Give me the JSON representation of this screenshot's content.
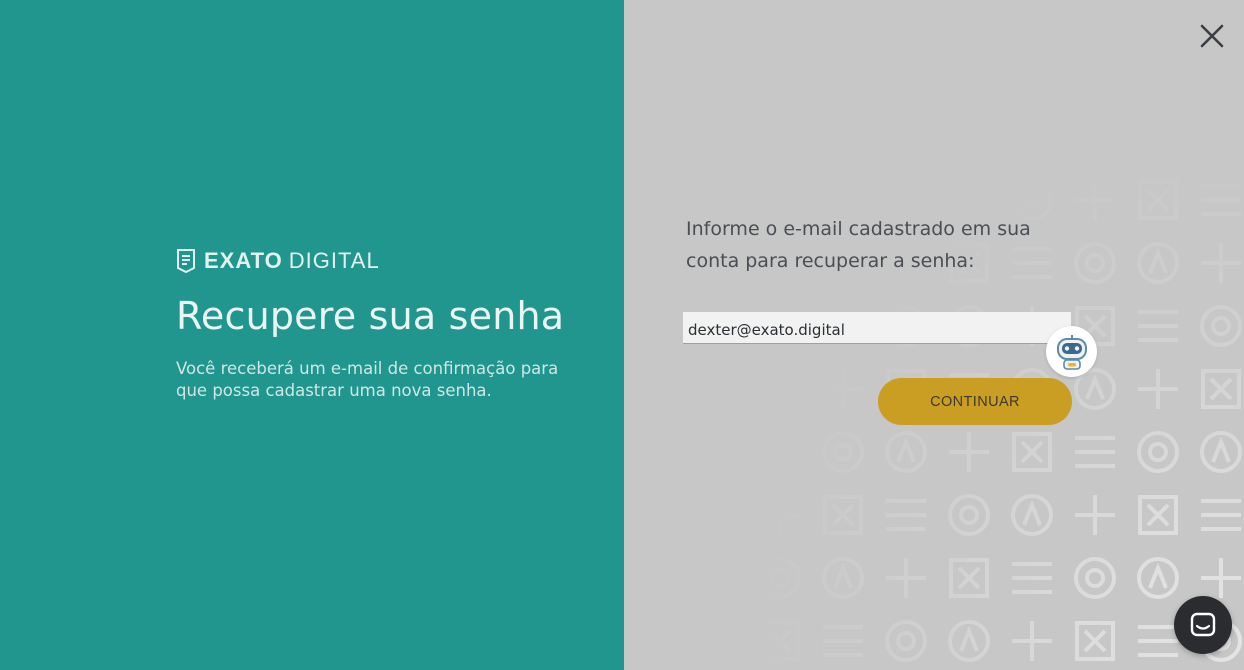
{
  "brand": {
    "name_bold": "EXATO",
    "name_light": "DIGITAL",
    "icon": "document-icon"
  },
  "left_panel": {
    "title": "Recupere sua senha",
    "description": "Você receberá um e-mail de confirmação para que possa cadastrar uma nova senha."
  },
  "form": {
    "instruction": "Informe o e-mail cadastrado em sua conta para recuperar a senha:",
    "email_value": "dexter@exato.digital",
    "continue_label": "CONTINUAR"
  },
  "icons": {
    "close": "close-icon",
    "bot": "robot-icon",
    "chat": "chat-icon"
  },
  "colors": {
    "left_panel_bg": "#21968f",
    "right_panel_bg": "#c6c7c6",
    "accent": "#c99e22",
    "chat_launcher": "#2a2c30"
  }
}
